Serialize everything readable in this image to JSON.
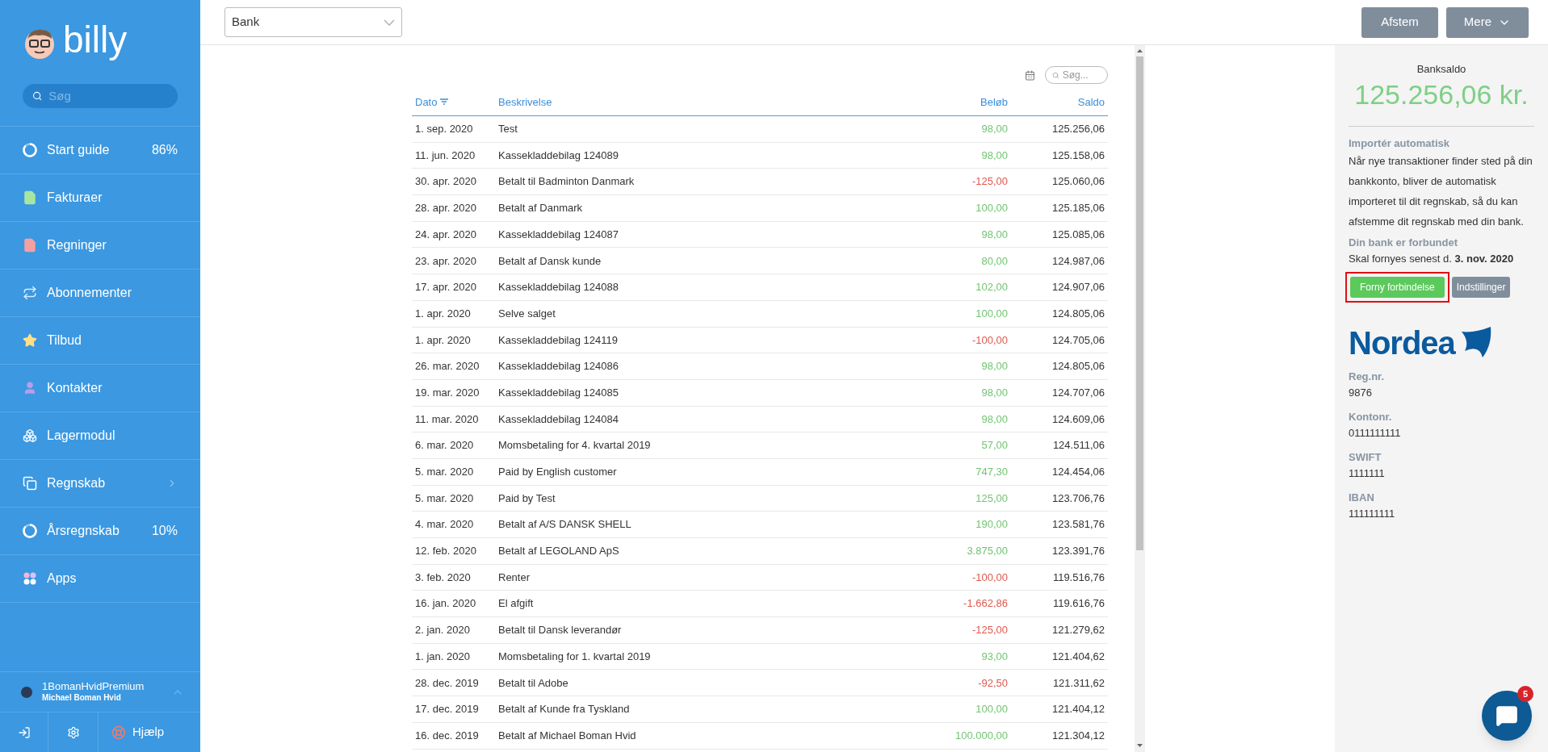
{
  "sidebar": {
    "logo": "billy",
    "search": {
      "placeholder": "Søg"
    },
    "items": [
      {
        "kind": "progress",
        "label": "Start guide",
        "percent": "86%"
      },
      {
        "kind": "invoice",
        "label": "Fakturaer"
      },
      {
        "kind": "bill",
        "label": "Regninger"
      },
      {
        "kind": "subscription",
        "label": "Abonnementer"
      },
      {
        "kind": "offer",
        "label": "Tilbud"
      },
      {
        "kind": "contact",
        "label": "Kontakter"
      },
      {
        "kind": "stock",
        "label": "Lagermodul"
      },
      {
        "kind": "submenu",
        "label": "Regnskab"
      },
      {
        "kind": "progress",
        "label": "Årsregnskab",
        "percent": "10%"
      },
      {
        "kind": "apps",
        "label": "Apps"
      }
    ],
    "user": {
      "org": "1BomanHvidPremium",
      "name": "Michael Boman Hvid"
    },
    "help": "Hjælp"
  },
  "toolbar": {
    "account_select": "Bank",
    "buttons": [
      "Afstem",
      "Mere"
    ]
  },
  "table": {
    "search": {
      "placeholder": "Søg..."
    },
    "columns": [
      "Dato",
      "Beskrivelse",
      "Beløb",
      "Saldo"
    ],
    "rows": [
      {
        "date": "1. sep. 2020",
        "description": "Test",
        "amount": {
          "text": "98,00",
          "color": "#72c472"
        },
        "balance": "125.256,06"
      },
      {
        "date": "11. jun. 2020",
        "description": "Kassekladdebilag 124089",
        "amount": {
          "text": "98,00",
          "color": "#72c472"
        },
        "balance": "125.158,06"
      },
      {
        "date": "30. apr. 2020",
        "description": "Betalt til Badminton Danmark",
        "amount": {
          "text": "-125,00",
          "color": "#e0584f"
        },
        "balance": "125.060,06"
      },
      {
        "date": "28. apr. 2020",
        "description": "Betalt af Danmark",
        "amount": {
          "text": "100,00",
          "color": "#72c472"
        },
        "balance": "125.185,06"
      },
      {
        "date": "24. apr. 2020",
        "description": "Kassekladdebilag 124087",
        "amount": {
          "text": "98,00",
          "color": "#72c472"
        },
        "balance": "125.085,06"
      },
      {
        "date": "23. apr. 2020",
        "description": "Betalt af Dansk kunde",
        "amount": {
          "text": "80,00",
          "color": "#72c472"
        },
        "balance": "124.987,06"
      },
      {
        "date": "17. apr. 2020",
        "description": "Kassekladdebilag 124088",
        "amount": {
          "text": "102,00",
          "color": "#72c472"
        },
        "balance": "124.907,06"
      },
      {
        "date": "1. apr. 2020",
        "description": "Selve salget",
        "amount": {
          "text": "100,00",
          "color": "#72c472"
        },
        "balance": "124.805,06"
      },
      {
        "date": "1. apr. 2020",
        "description": "Kassekladdebilag 124119",
        "amount": {
          "text": "-100,00",
          "color": "#e0584f"
        },
        "balance": "124.705,06"
      },
      {
        "date": "26. mar. 2020",
        "description": "Kassekladdebilag 124086",
        "amount": {
          "text": "98,00",
          "color": "#72c472"
        },
        "balance": "124.805,06"
      },
      {
        "date": "19. mar. 2020",
        "description": "Kassekladdebilag 124085",
        "amount": {
          "text": "98,00",
          "color": "#72c472"
        },
        "balance": "124.707,06"
      },
      {
        "date": "11. mar. 2020",
        "description": "Kassekladdebilag 124084",
        "amount": {
          "text": "98,00",
          "color": "#72c472"
        },
        "balance": "124.609,06"
      },
      {
        "date": "6. mar. 2020",
        "description": "Momsbetaling for 4. kvartal 2019",
        "amount": {
          "text": "57,00",
          "color": "#72c472"
        },
        "balance": "124.511,06"
      },
      {
        "date": "5. mar. 2020",
        "description": "Paid by English customer",
        "amount": {
          "text": "747,30",
          "color": "#72c472"
        },
        "balance": "124.454,06"
      },
      {
        "date": "5. mar. 2020",
        "description": "Paid by Test",
        "amount": {
          "text": "125,00",
          "color": "#72c472"
        },
        "balance": "123.706,76"
      },
      {
        "date": "4. mar. 2020",
        "description": "Betalt af A/S DANSK SHELL",
        "amount": {
          "text": "190,00",
          "color": "#72c472"
        },
        "balance": "123.581,76"
      },
      {
        "date": "12. feb. 2020",
        "description": "Betalt af LEGOLAND ApS",
        "amount": {
          "text": "3.875,00",
          "color": "#72c472"
        },
        "balance": "123.391,76"
      },
      {
        "date": "3. feb. 2020",
        "description": "Renter",
        "amount": {
          "text": "-100,00",
          "color": "#e0584f"
        },
        "balance": "119.516,76"
      },
      {
        "date": "16. jan. 2020",
        "description": "El afgift",
        "amount": {
          "text": "-1.662,86",
          "color": "#e0584f"
        },
        "balance": "119.616,76"
      },
      {
        "date": "2. jan. 2020",
        "description": "Betalt til Dansk leverandør",
        "amount": {
          "text": "-125,00",
          "color": "#e0584f"
        },
        "balance": "121.279,62"
      },
      {
        "date": "1. jan. 2020",
        "description": "Momsbetaling for 1. kvartal 2019",
        "amount": {
          "text": "93,00",
          "color": "#72c472"
        },
        "balance": "121.404,62"
      },
      {
        "date": "28. dec. 2019",
        "description": "Betalt til Adobe",
        "amount": {
          "text": "-92,50",
          "color": "#e0584f"
        },
        "balance": "121.311,62"
      },
      {
        "date": "17. dec. 2019",
        "description": "Betalt af Kunde fra Tyskland",
        "amount": {
          "text": "100,00",
          "color": "#72c472"
        },
        "balance": "121.404,12"
      },
      {
        "date": "16. dec. 2019",
        "description": "Betalt af Michael Boman Hvid",
        "amount": {
          "text": "100.000,00",
          "color": "#72c472"
        },
        "balance": "121.304,12"
      }
    ]
  },
  "bank_panel": {
    "balance_label": "Banksaldo",
    "balance": "125.256,06 kr.",
    "import_heading": "Importér automatisk",
    "import_text": "Når nye transaktioner finder sted på din bankkonto, bliver de automatisk importeret til dit regnskab, så du kan afstemme dit regnskab med din bank.",
    "connection_heading": "Din bank er forbundet",
    "renewal_text": "Skal fornyes senest d. **3. nov. 2020**",
    "buttons": [
      "Forny forbindelse",
      "Indstillinger"
    ],
    "highlighted": true,
    "bank_logo": "Nordea",
    "fields": [
      {
        "label": "Reg.nr.",
        "value": "9876"
      },
      {
        "label": "Kontonr.",
        "value": "0111111111"
      },
      {
        "label": "SWIFT",
        "value": "1111111"
      },
      {
        "label": "IBAN",
        "value": "111111111"
      }
    ]
  },
  "chat": {
    "badge": "5"
  }
}
